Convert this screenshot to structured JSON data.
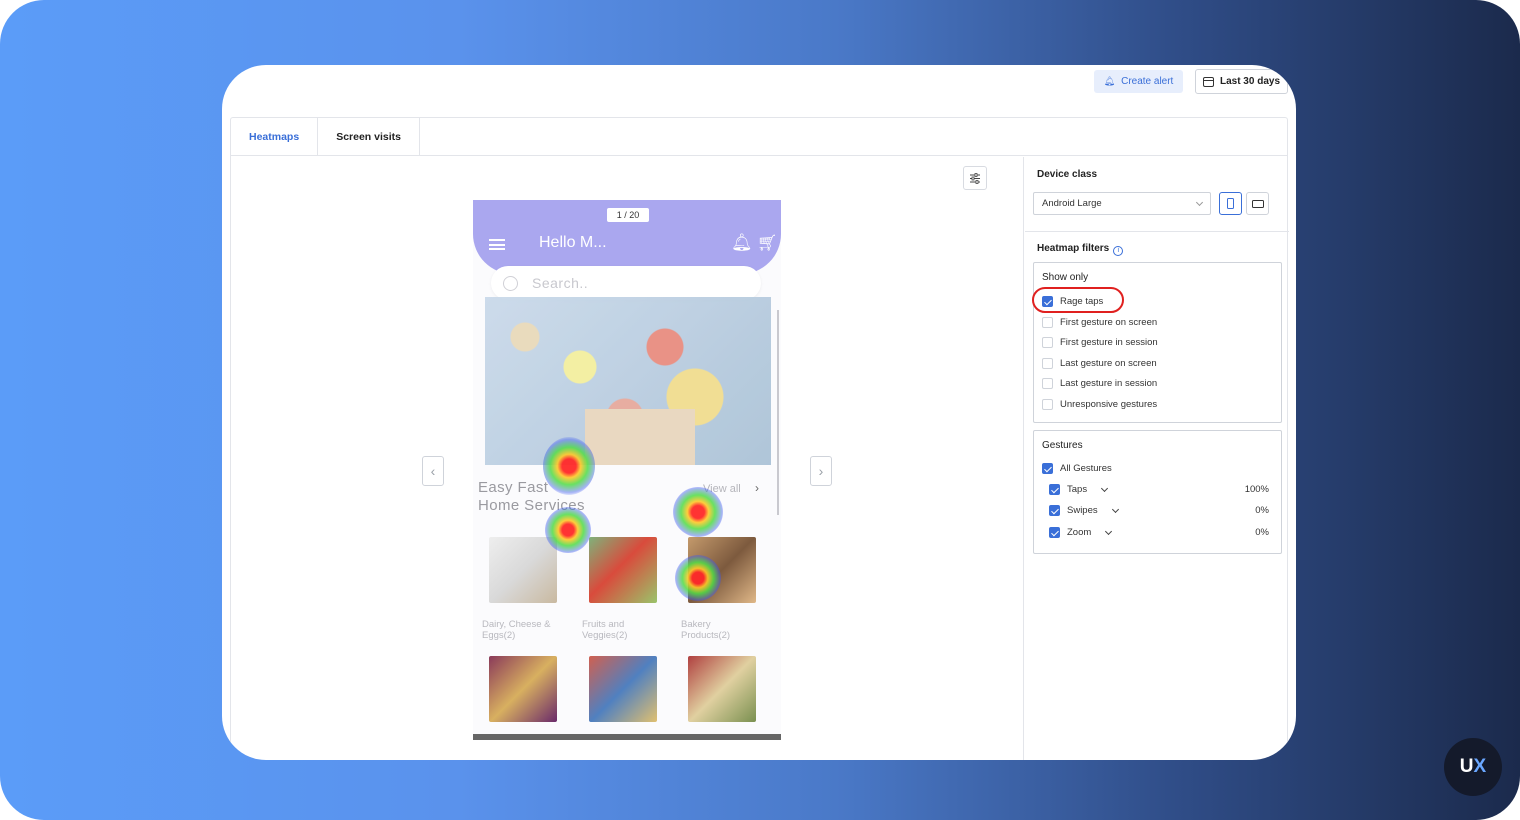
{
  "toolbar": {
    "create_alert_label": "Create alert",
    "date_range_label": "Last 30 days"
  },
  "tabs": [
    {
      "label": "Heatmaps",
      "active": true
    },
    {
      "label": "Screen visits",
      "active": false
    }
  ],
  "viewer": {
    "page_counter": "1 / 20",
    "prev_icon": "chevron-left-icon",
    "next_icon": "chevron-right-icon"
  },
  "app_screen": {
    "greeting": "Hello M...",
    "search_placeholder": "Search..",
    "section_title_line1": "Easy Fast",
    "section_title_line2": "Home Services",
    "view_all": "View all",
    "categories": [
      {
        "line1": "Dairy, Cheese &",
        "line2": "Eggs(2)"
      },
      {
        "line1": "Fruits and",
        "line2": "Veggies(2)"
      },
      {
        "line1": "Bakery",
        "line2": "Products(2)"
      }
    ],
    "header_color": "#aaa7ef"
  },
  "sidebar": {
    "device_class_label": "Device class",
    "device_selected": "Android Large",
    "heatmap_filters_label": "Heatmap filters",
    "show_only_label": "Show only",
    "show_only_options": [
      {
        "label": "Rage taps",
        "checked": true
      },
      {
        "label": "First gesture on screen",
        "checked": false
      },
      {
        "label": "First gesture in session",
        "checked": false
      },
      {
        "label": "Last gesture on screen",
        "checked": false
      },
      {
        "label": "Last gesture in session",
        "checked": false
      },
      {
        "label": "Unresponsive gestures",
        "checked": false
      }
    ],
    "gestures_label": "Gestures",
    "all_gestures_label": "All Gestures",
    "gestures": [
      {
        "label": "Taps",
        "value": "100%",
        "checked": true
      },
      {
        "label": "Swipes",
        "value": "0%",
        "checked": true
      },
      {
        "label": "Zoom",
        "value": "0%",
        "checked": true
      }
    ]
  },
  "badge": {
    "u": "U",
    "x": "X"
  },
  "colors": {
    "accent": "#3a6fd8",
    "highlight": "#e0201f"
  }
}
